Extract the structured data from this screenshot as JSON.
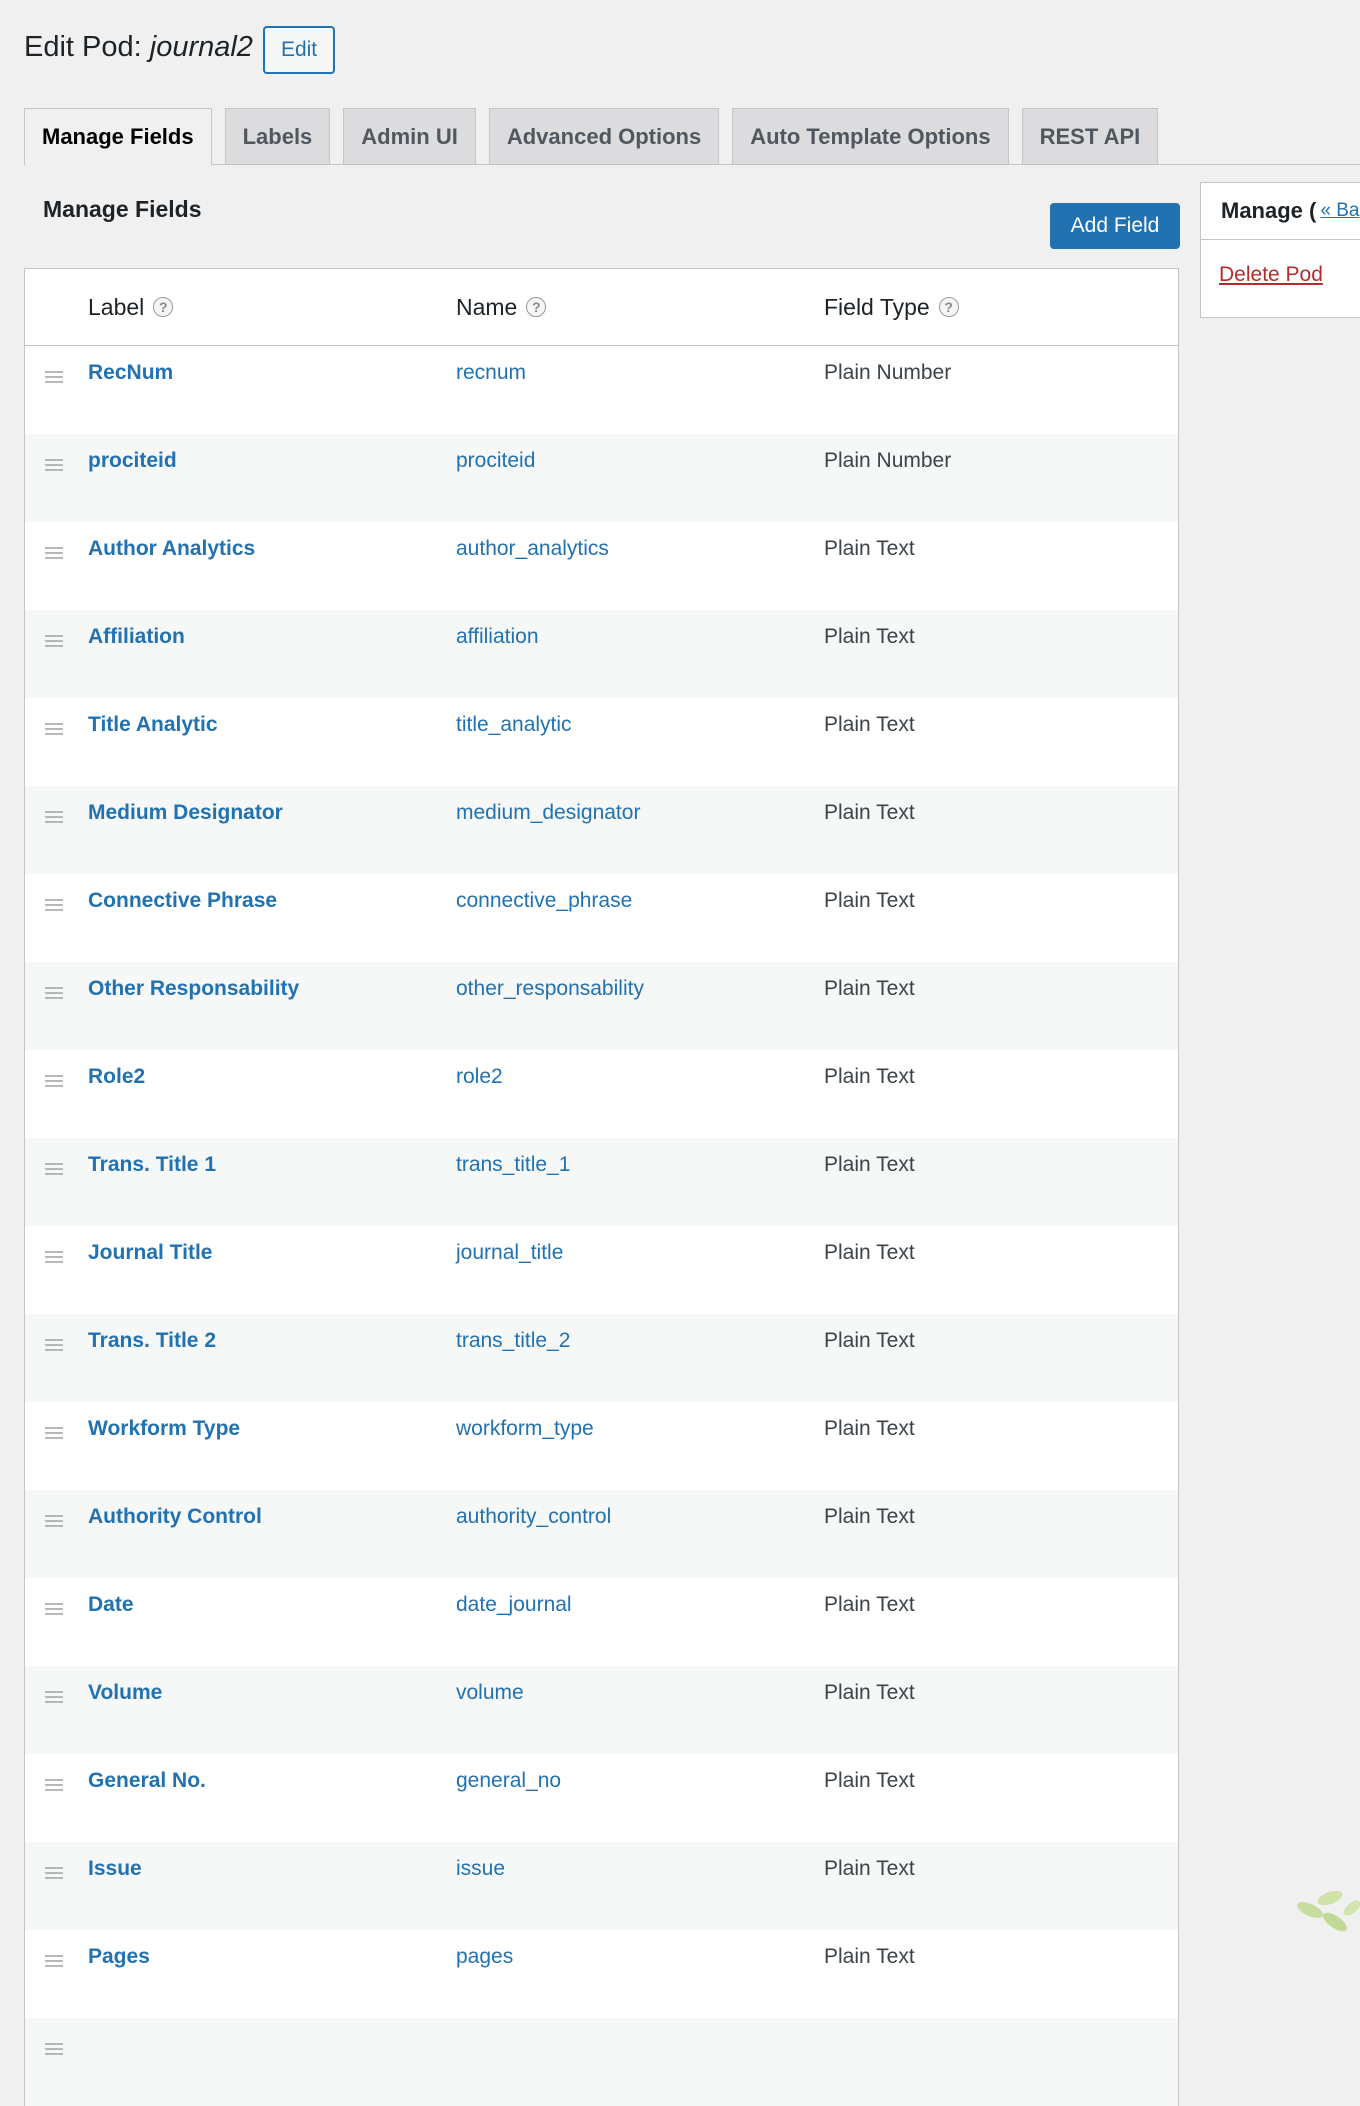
{
  "header": {
    "title_prefix": "Edit Pod:",
    "pod_name": "journal2",
    "edit_label": "Edit"
  },
  "tabs": [
    {
      "label": "Manage Fields",
      "active": true
    },
    {
      "label": "Labels"
    },
    {
      "label": "Admin UI"
    },
    {
      "label": "Advanced Options"
    },
    {
      "label": "Auto Template Options"
    },
    {
      "label": "REST API"
    }
  ],
  "main": {
    "section_title": "Manage Fields",
    "add_field_label": "Add Field"
  },
  "table": {
    "headers": {
      "label": "Label",
      "name": "Name",
      "type": "Field Type"
    },
    "help_glyph": "?",
    "rows": [
      {
        "label": "RecNum",
        "name": "recnum",
        "type": "Plain Number"
      },
      {
        "label": "prociteid",
        "name": "prociteid",
        "type": "Plain Number"
      },
      {
        "label": "Author Analytics",
        "name": "author_analytics",
        "type": "Plain Text"
      },
      {
        "label": "Affiliation",
        "name": "affiliation",
        "type": "Plain Text"
      },
      {
        "label": "Title Analytic",
        "name": "title_analytic",
        "type": "Plain Text"
      },
      {
        "label": "Medium Designator",
        "name": "medium_designator",
        "type": "Plain Text"
      },
      {
        "label": "Connective Phrase",
        "name": "connective_phrase",
        "type": "Plain Text"
      },
      {
        "label": "Other Responsability",
        "name": "other_responsability",
        "type": "Plain Text"
      },
      {
        "label": "Role2",
        "name": "role2",
        "type": "Plain Text"
      },
      {
        "label": "Trans. Title 1",
        "name": "trans_title_1",
        "type": "Plain Text"
      },
      {
        "label": "Journal Title",
        "name": "journal_title",
        "type": "Plain Text"
      },
      {
        "label": "Trans. Title 2",
        "name": "trans_title_2",
        "type": "Plain Text"
      },
      {
        "label": "Workform Type",
        "name": "workform_type",
        "type": "Plain Text"
      },
      {
        "label": "Authority Control",
        "name": "authority_control",
        "type": "Plain Text"
      },
      {
        "label": "Date",
        "name": "date_journal",
        "type": "Plain Text"
      },
      {
        "label": "Volume",
        "name": "volume",
        "type": "Plain Text"
      },
      {
        "label": "General No.",
        "name": "general_no",
        "type": "Plain Text"
      },
      {
        "label": "Issue",
        "name": "issue",
        "type": "Plain Text"
      },
      {
        "label": "Pages",
        "name": "pages",
        "type": "Plain Text"
      },
      {
        "label": "",
        "name": "",
        "type": ""
      }
    ]
  },
  "sidebar": {
    "title": "Manage",
    "back_link": "« Ba",
    "delete_label": "Delete Pod"
  },
  "colors": {
    "link": "#2271b1",
    "danger": "#b32d2e",
    "primary_button": "#2271b1"
  }
}
